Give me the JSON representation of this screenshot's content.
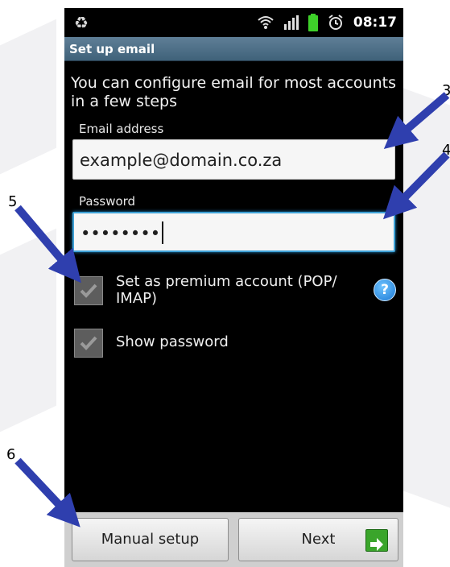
{
  "status_bar": {
    "time": "08:17",
    "icons": [
      "recycle-icon",
      "wifi-icon",
      "signal-icon",
      "battery-icon",
      "alarm-icon"
    ]
  },
  "title_bar": {
    "title": "Set up email"
  },
  "intro_text": "You can configure email for most accounts in a few steps",
  "email": {
    "label": "Email address",
    "value": "example@domain.co.za"
  },
  "password": {
    "label": "Password",
    "value": "••••••••"
  },
  "premium_checkbox": {
    "label": "Set as premium account (POP/ IMAP)",
    "checked": true
  },
  "show_password_checkbox": {
    "label": "Show password",
    "checked": true
  },
  "help_button": {
    "glyph": "?"
  },
  "buttons": {
    "manual_setup": "Manual setup",
    "next": "Next"
  },
  "annotations": [
    "3",
    "4",
    "5",
    "6"
  ],
  "colors": {
    "title_bar": "#4a6c84",
    "focus_border": "#3ea1d6",
    "arrow": "#2f3fae",
    "next_icon": "#3aa52b"
  }
}
